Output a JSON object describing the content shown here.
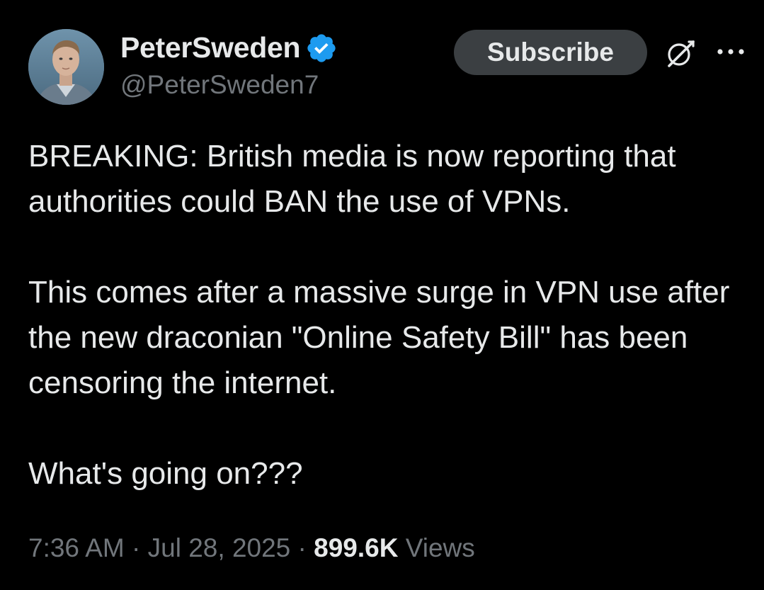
{
  "theme": {
    "background": "#000000",
    "text_primary": "#e7e9ea",
    "text_secondary": "#71767b",
    "verified_blue": "#1d9bf0",
    "subscribe_bg": "#3b3f42"
  },
  "author": {
    "display_name": "PeterSweden",
    "handle": "@PeterSweden7",
    "verified": true,
    "avatar_icon": "profile-photo"
  },
  "actions": {
    "subscribe_label": "Subscribe",
    "grok_icon": "grok-icon",
    "more_icon": "more-options-icon"
  },
  "post": {
    "paragraphs": [
      "BREAKING: British media is now reporting that authorities could BAN the use of VPNs.",
      "This comes after a massive surge in VPN use after the new draconian \"Online Safety Bill\" has been censoring the internet.",
      "What's going on???"
    ]
  },
  "meta": {
    "time": "7:36 AM",
    "sep1": " · ",
    "date": "Jul 28, 2025",
    "sep2": " · ",
    "views_count": "899.6K",
    "views_label": " Views"
  }
}
